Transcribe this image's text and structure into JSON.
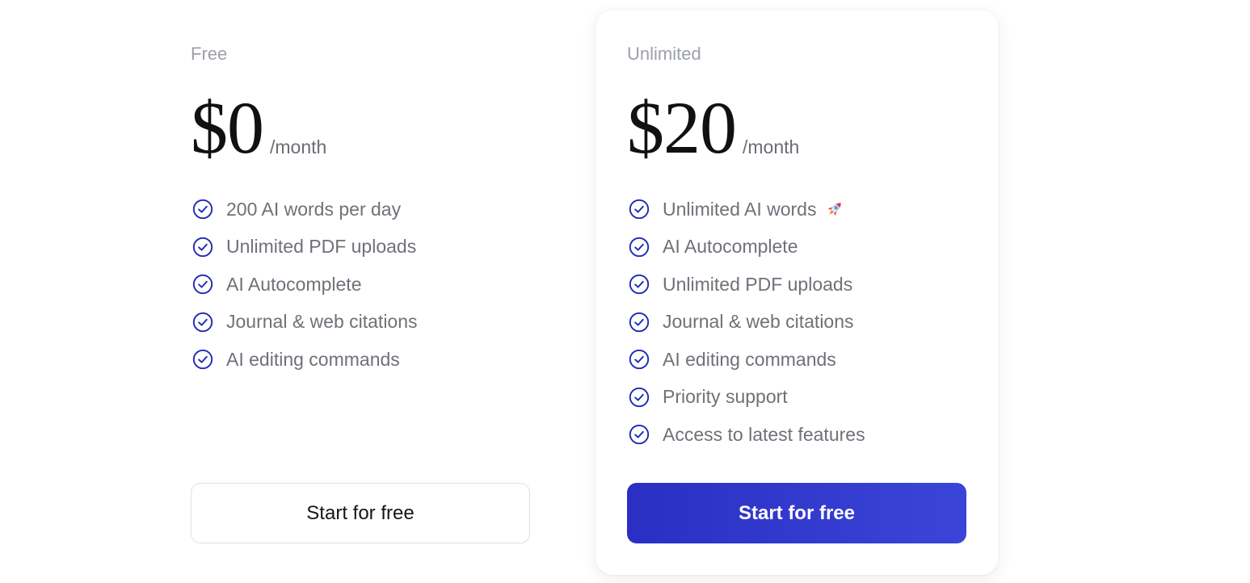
{
  "colors": {
    "accent": "#2a30c4",
    "check_icon": "#1f2ab4",
    "muted_text": "#707079",
    "plan_label": "#9ca0a8"
  },
  "plans": [
    {
      "name": "Free",
      "price": "$0",
      "period": "/month",
      "features": [
        {
          "label": "200 AI words per day",
          "icon": "check-circle-icon"
        },
        {
          "label": "Unlimited PDF uploads",
          "icon": "check-circle-icon"
        },
        {
          "label": "AI Autocomplete",
          "icon": "check-circle-icon"
        },
        {
          "label": "Journal & web citations",
          "icon": "check-circle-icon"
        },
        {
          "label": "AI editing commands",
          "icon": "check-circle-icon"
        }
      ],
      "cta": "Start for free"
    },
    {
      "name": "Unlimited",
      "price": "$20",
      "period": "/month",
      "features": [
        {
          "label": "Unlimited AI words",
          "icon": "check-circle-icon",
          "extra_icon": "rocket-icon"
        },
        {
          "label": "AI Autocomplete",
          "icon": "check-circle-icon"
        },
        {
          "label": "Unlimited PDF uploads",
          "icon": "check-circle-icon"
        },
        {
          "label": "Journal & web citations",
          "icon": "check-circle-icon"
        },
        {
          "label": "AI editing commands",
          "icon": "check-circle-icon"
        },
        {
          "label": "Priority support",
          "icon": "check-circle-icon"
        },
        {
          "label": "Access to latest features",
          "icon": "check-circle-icon"
        }
      ],
      "cta": "Start for free"
    }
  ]
}
